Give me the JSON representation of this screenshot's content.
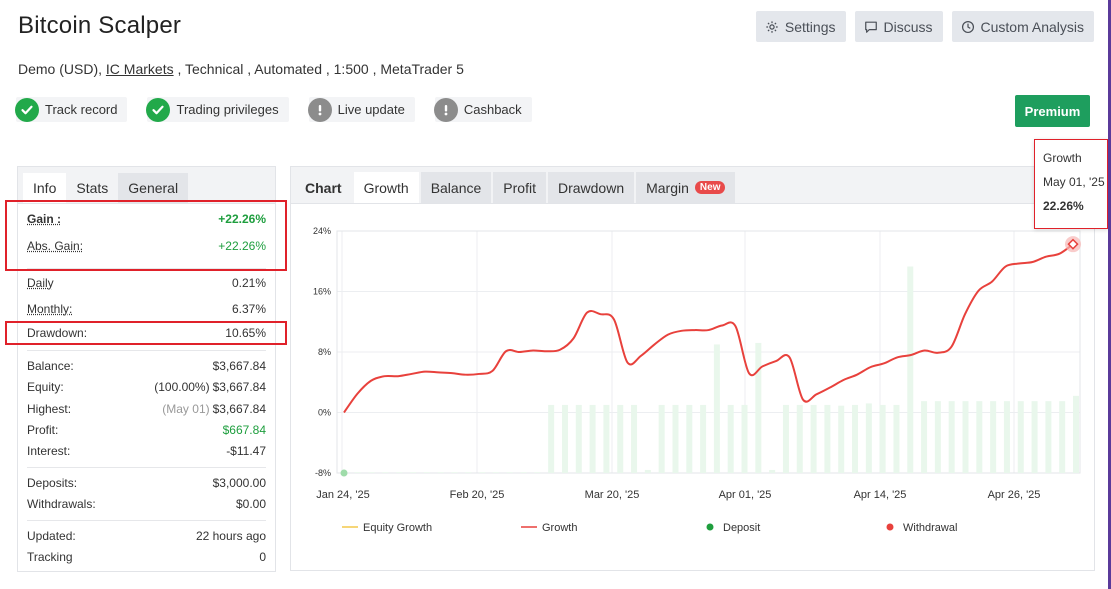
{
  "header": {
    "title": "Bitcoin Scalper",
    "buttons": [
      {
        "label": "Settings",
        "icon": "gear-icon"
      },
      {
        "label": "Discuss",
        "icon": "chat-icon"
      },
      {
        "label": "Custom Analysis",
        "icon": "clock-icon"
      }
    ],
    "meta": {
      "account": "Demo (USD),",
      "broker": "IC Markets",
      "rest": " , Technical , Automated , 1:500 , MetaTrader 5"
    },
    "badges": [
      {
        "label": "Track record",
        "status": "ok"
      },
      {
        "label": "Trading privileges",
        "status": "ok"
      },
      {
        "label": "Live update",
        "status": "warn"
      },
      {
        "label": "Cashback",
        "status": "warn"
      }
    ],
    "premium_label": "Premium"
  },
  "info": {
    "tabs": [
      "Info",
      "Stats",
      "General"
    ],
    "gain_label": "Gain :",
    "gain_value": "+22.26%",
    "abs_gain_label": "Abs. Gain:",
    "abs_gain_value": "+22.26%",
    "daily_label": "Daily",
    "daily_value": "0.21%",
    "monthly_label": "Monthly:",
    "monthly_value": "6.37%",
    "drawdown_label": "Drawdown:",
    "drawdown_value": "10.65%",
    "balance_label": "Balance:",
    "balance_value": "$3,667.84",
    "equity_label": "Equity:",
    "equity_sub": "(100.00%)",
    "equity_value": "$3,667.84",
    "highest_label": "Highest:",
    "highest_sub": "(May 01)",
    "highest_value": "$3,667.84",
    "profit_label": "Profit:",
    "profit_value": "$667.84",
    "interest_label": "Interest:",
    "interest_value": "-$11.47",
    "deposits_label": "Deposits:",
    "deposits_value": "$3,000.00",
    "withdrawals_label": "Withdrawals:",
    "withdrawals_value": "$0.00",
    "updated_label": "Updated:",
    "updated_value": "22 hours ago",
    "tracking_label": "Tracking",
    "tracking_value": "0"
  },
  "chart_tabs": {
    "label": "Chart",
    "tabs": [
      "Growth",
      "Balance",
      "Profit",
      "Drawdown",
      "Margin"
    ],
    "new_badge": "New"
  },
  "tooltip": {
    "series": "Growth",
    "date": "May 01, '25",
    "value": "22.26%"
  },
  "colors": {
    "growth_line": "#e8413c",
    "equity_line": "#f2c84b",
    "deposit": "#1e9e3e",
    "withdrawal": "#e8413c",
    "bars": "#e9f7ec",
    "premium": "#1e9e5e",
    "highlight_box": "#e0212a"
  },
  "chart_data": {
    "type": "line",
    "y_ticks": [
      "24%",
      "16%",
      "8%",
      "0%",
      "-8%"
    ],
    "ylim": [
      -8,
      24
    ],
    "x_ticks": [
      "Jan 24, '25",
      "Feb 20, '25",
      "Mar 20, '25",
      "Apr 01, '25",
      "Apr 14, '25",
      "Apr 26, '25"
    ],
    "legend": [
      "Equity Growth",
      "Growth",
      "Deposit",
      "Withdrawal"
    ],
    "series": [
      {
        "name": "Growth",
        "values": [
          0.0,
          2.5,
          4.2,
          4.8,
          4.8,
          5.1,
          5.4,
          5.3,
          5.2,
          5.0,
          5.1,
          5.5,
          8.1,
          8.0,
          8.2,
          8.1,
          8.3,
          9.8,
          13.2,
          13.0,
          12.3,
          6.6,
          7.5,
          9.0,
          10.3,
          10.8,
          10.9,
          10.9,
          11.5,
          11.4,
          5.2,
          6.1,
          6.8,
          7.3,
          1.7,
          2.4,
          3.3,
          4.3,
          5.0,
          6.0,
          6.5,
          7.3,
          7.6,
          8.2,
          7.9,
          8.7,
          13.0,
          16.1,
          17.3,
          19.3,
          19.7,
          19.9,
          20.6,
          21.0,
          22.26
        ]
      },
      {
        "name": "Deposit",
        "values": [
          -8.0
        ]
      },
      {
        "name": "Daily bars",
        "values": [
          -7.9,
          -7.9,
          -7.9,
          -7.9,
          -7.9,
          -7.9,
          -7.9,
          -7.9,
          -7.9,
          -7.9,
          -7.9,
          -7.9,
          -7.9,
          -7.9,
          -7.9,
          1.0,
          1.0,
          1.0,
          1.0,
          1.0,
          1.0,
          1.0,
          -7.6,
          1.0,
          1.0,
          1.0,
          1.0,
          9.0,
          1.0,
          1.0,
          9.2,
          -7.6,
          1.0,
          1.0,
          1.0,
          1.0,
          0.9,
          1.0,
          1.2,
          1.0,
          1.0,
          19.3,
          1.5,
          1.5,
          1.5,
          1.5,
          1.5,
          1.5,
          1.5,
          1.5,
          1.5,
          1.5,
          1.5,
          2.2
        ]
      }
    ]
  }
}
